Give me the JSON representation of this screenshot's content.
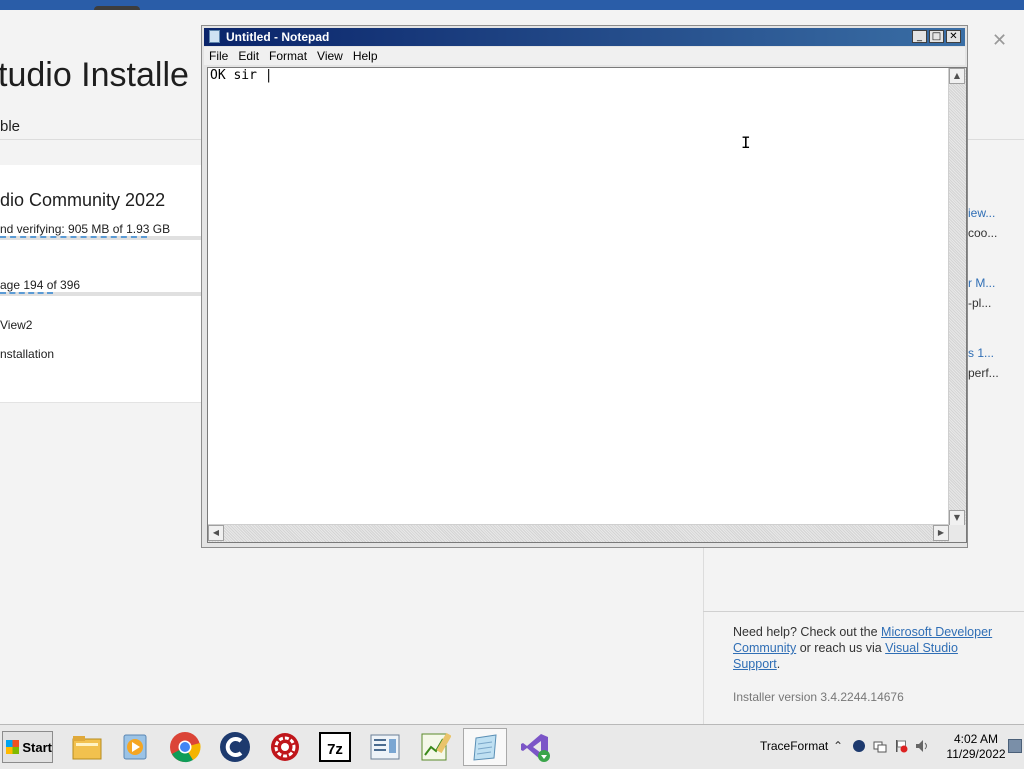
{
  "installer": {
    "title": "tudio Installe",
    "tab_label": "ble",
    "card": {
      "product": "dio Community 2022",
      "download_status": "nd verifying: 905 MB of 1.93 GB",
      "download_progress": 0.7,
      "package_status": "age 194 of 396",
      "package_progress": 0.25,
      "item1": "View2",
      "item2": "nstallation"
    },
    "close_glyph": "✕",
    "right_pane": [
      {
        "text": "iew...",
        "kind": "link"
      },
      {
        "text": "coo...",
        "kind": "text"
      },
      {
        "text": "r M...",
        "kind": "link"
      },
      {
        "text": "-pl...",
        "kind": "text"
      },
      {
        "text": "s 1...",
        "kind": "link"
      },
      {
        "text": "perf...",
        "kind": "text"
      }
    ],
    "help": {
      "prefix": "Need help? Check out the ",
      "link1": "Microsoft Developer Community",
      "middle": " or reach us via ",
      "link2": "Visual Studio Support",
      "suffix": "."
    },
    "version": "Installer version 3.4.2244.14676"
  },
  "notepad": {
    "title": "Untitled - Notepad",
    "menu": [
      "File",
      "Edit",
      "Format",
      "View",
      "Help"
    ],
    "content": "OK sir |",
    "buttons": {
      "minimize": "_",
      "maximize": "□",
      "close": "✕"
    },
    "scroll": {
      "up": "▲",
      "down": "▼",
      "left": "◀",
      "right": "▶"
    }
  },
  "taskbar": {
    "start_label": "Start",
    "apps": [
      {
        "name": "file-explorer-icon",
        "active": false
      },
      {
        "name": "media-player-icon",
        "active": false
      },
      {
        "name": "chrome-icon",
        "active": false
      },
      {
        "name": "ccleaner-icon",
        "active": false
      },
      {
        "name": "red-gear-app-icon",
        "active": false
      },
      {
        "name": "7zip-icon",
        "active": false
      },
      {
        "name": "document-viewer-icon",
        "active": false
      },
      {
        "name": "chart-app-icon",
        "active": false
      },
      {
        "name": "notepad-icon",
        "active": true
      },
      {
        "name": "vs-installer-icon",
        "active": false
      }
    ],
    "toolbar_label": "TraceFormat",
    "clock_time": "4:02 AM",
    "clock_date": "11/29/2022",
    "tray_expand": "⌃"
  },
  "colors": {
    "titlebar_start": "#0a246a",
    "titlebar_end": "#3a6ea5",
    "link": "#2f6eb5",
    "progress": "#5b9bd5"
  }
}
